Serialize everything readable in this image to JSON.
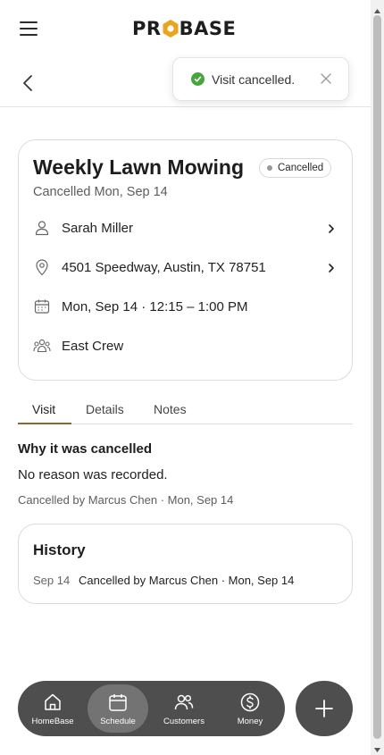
{
  "header": {
    "brand": {
      "left": "PR",
      "right": "BASE",
      "accent": "#e8a51d"
    }
  },
  "toast": {
    "message": "Visit cancelled.",
    "icon": "check-circle-icon",
    "color": "#46a53d"
  },
  "visit": {
    "title": "Weekly Lawn Mowing",
    "status": "Cancelled",
    "subtitle": "Cancelled Mon, Sep 14",
    "customer": "Sarah Miller",
    "address": "4501 Speedway, Austin, TX 78751",
    "schedule": "Mon, Sep 14 · 12:15 – 1:00 PM",
    "crew": "East Crew"
  },
  "tabs": {
    "visit": "Visit",
    "details": "Details",
    "notes": "Notes",
    "active": "Visit",
    "accent": "#8a6a28"
  },
  "cancellation": {
    "heading": "Why it was cancelled",
    "reason": "No reason was recorded.",
    "meta": "Cancelled by Marcus Chen · Mon, Sep 14"
  },
  "history": {
    "title": "History",
    "entries": [
      {
        "date": "Sep 14",
        "text": "Cancelled by Marcus Chen · Mon, Sep 14"
      }
    ]
  },
  "nav": {
    "items": [
      {
        "label": "HomeBase",
        "icon": "home-icon"
      },
      {
        "label": "Schedule",
        "icon": "calendar-icon",
        "active": true
      },
      {
        "label": "Customers",
        "icon": "customers-icon"
      },
      {
        "label": "Money",
        "icon": "dollar-icon"
      }
    ],
    "fab_icon": "plus-icon"
  }
}
